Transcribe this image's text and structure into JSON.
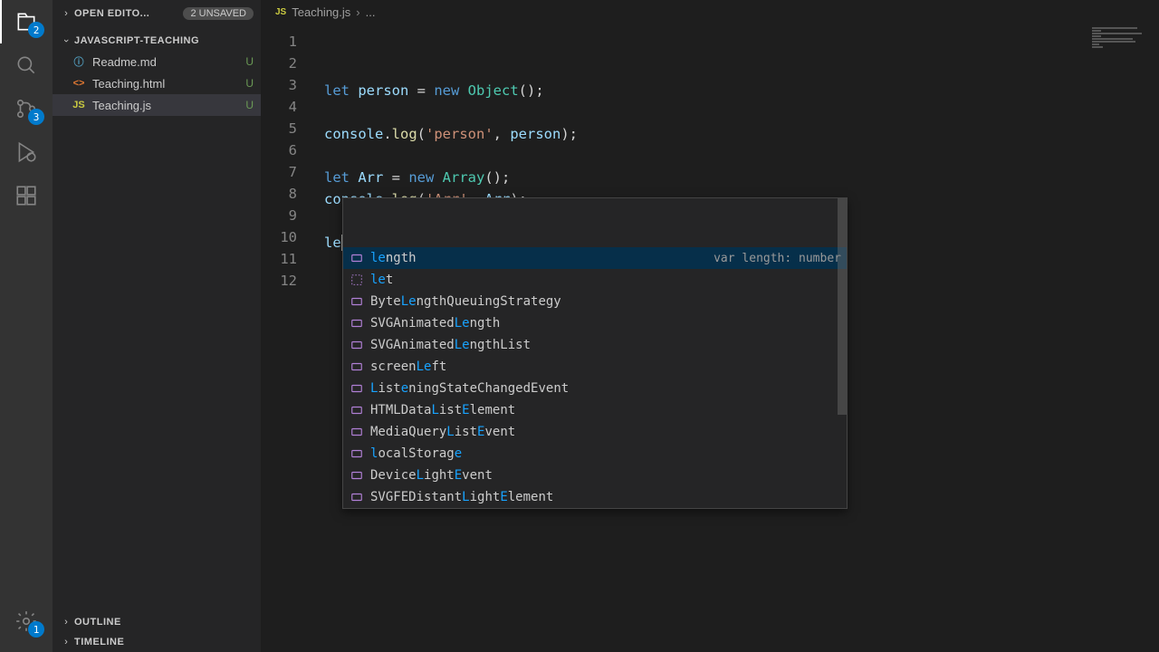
{
  "activity": {
    "explorer_badge": "2",
    "scm_badge": "3",
    "settings_badge": "1"
  },
  "sidebar": {
    "open_editors_label": "OPEN EDITO...",
    "unsaved_label": "2 UNSAVED",
    "project_label": "JAVASCRIPT-TEACHING",
    "files": [
      {
        "name": "Readme.md",
        "status": "U",
        "icon": "ⓘ",
        "color": "#519aba"
      },
      {
        "name": "Teaching.html",
        "status": "U",
        "icon": "<>",
        "color": "#e37933"
      },
      {
        "name": "Teaching.js",
        "status": "U",
        "icon": "JS",
        "color": "#cbcb41"
      }
    ],
    "outline_label": "OUTLINE",
    "timeline_label": "TIMELINE"
  },
  "breadcrumb": {
    "icon": "JS",
    "file": "Teaching.js",
    "rest": "..."
  },
  "code": {
    "lines": [
      {
        "n": 1,
        "tokens": [
          [
            "let ",
            "keyword"
          ],
          [
            "person ",
            "var"
          ],
          [
            "= ",
            "op"
          ],
          [
            "new ",
            "new"
          ],
          [
            "Object",
            "class"
          ],
          [
            "();",
            "punc"
          ]
        ]
      },
      {
        "n": 2,
        "tokens": []
      },
      {
        "n": 3,
        "tokens": [
          [
            "console",
            "obj"
          ],
          [
            ".",
            "punc"
          ],
          [
            "log",
            "func"
          ],
          [
            "(",
            "punc"
          ],
          [
            "'person'",
            "string"
          ],
          [
            ", ",
            "punc"
          ],
          [
            "person",
            "var"
          ],
          [
            ");",
            "punc"
          ]
        ]
      },
      {
        "n": 4,
        "tokens": []
      },
      {
        "n": 5,
        "tokens": [
          [
            "let ",
            "keyword"
          ],
          [
            "Arr ",
            "var"
          ],
          [
            "= ",
            "op"
          ],
          [
            "new ",
            "new"
          ],
          [
            "Array",
            "class"
          ],
          [
            "();",
            "punc"
          ]
        ]
      },
      {
        "n": 6,
        "tokens": [
          [
            "console",
            "obj"
          ],
          [
            ".",
            "punc"
          ],
          [
            "log",
            "func"
          ],
          [
            "(",
            "punc"
          ],
          [
            "'Arr'",
            "string"
          ],
          [
            ", ",
            "punc"
          ],
          [
            "Arr",
            "var"
          ],
          [
            ");",
            "punc"
          ]
        ]
      },
      {
        "n": 7,
        "tokens": []
      },
      {
        "n": 8,
        "tokens": [
          [
            "le",
            "var"
          ]
        ]
      },
      {
        "n": 9,
        "tokens": []
      },
      {
        "n": 10,
        "tokens": []
      },
      {
        "n": 11,
        "tokens": []
      },
      {
        "n": 12,
        "tokens": []
      }
    ]
  },
  "autocomplete": {
    "detail": "var length: number",
    "items": [
      {
        "parts": [
          [
            "le",
            true
          ],
          [
            "ngth",
            false
          ]
        ],
        "icon": "var",
        "selected": true
      },
      {
        "parts": [
          [
            "le",
            true
          ],
          [
            "t",
            false
          ]
        ],
        "icon": "snippet"
      },
      {
        "parts": [
          [
            "Byte",
            false
          ],
          [
            "Le",
            true
          ],
          [
            "ngthQueuingStrategy",
            false
          ]
        ],
        "icon": "var"
      },
      {
        "parts": [
          [
            "SVGAnimated",
            false
          ],
          [
            "Le",
            true
          ],
          [
            "ngth",
            false
          ]
        ],
        "icon": "var"
      },
      {
        "parts": [
          [
            "SVGAnimated",
            false
          ],
          [
            "Le",
            true
          ],
          [
            "ngthList",
            false
          ]
        ],
        "icon": "var"
      },
      {
        "parts": [
          [
            "screen",
            false
          ],
          [
            "Le",
            true
          ],
          [
            "ft",
            false
          ]
        ],
        "icon": "var"
      },
      {
        "parts": [
          [
            "L",
            true
          ],
          [
            "ist",
            false
          ],
          [
            "e",
            true
          ],
          [
            "ningStateChangedEvent",
            false
          ]
        ],
        "icon": "var"
      },
      {
        "parts": [
          [
            "HTMLData",
            false
          ],
          [
            "L",
            true
          ],
          [
            "ist",
            false
          ],
          [
            "E",
            true
          ],
          [
            "lement",
            false
          ]
        ],
        "icon": "var"
      },
      {
        "parts": [
          [
            "MediaQuery",
            false
          ],
          [
            "L",
            true
          ],
          [
            "ist",
            false
          ],
          [
            "E",
            true
          ],
          [
            "vent",
            false
          ]
        ],
        "icon": "var"
      },
      {
        "parts": [
          [
            "l",
            true
          ],
          [
            "ocalStorag",
            false
          ],
          [
            "e",
            true
          ]
        ],
        "icon": "var"
      },
      {
        "parts": [
          [
            "Device",
            false
          ],
          [
            "L",
            true
          ],
          [
            "ight",
            false
          ],
          [
            "E",
            true
          ],
          [
            "vent",
            false
          ]
        ],
        "icon": "var"
      },
      {
        "parts": [
          [
            "SVGFEDistant",
            false
          ],
          [
            "L",
            true
          ],
          [
            "ight",
            false
          ],
          [
            "E",
            true
          ],
          [
            "lement",
            false
          ]
        ],
        "icon": "var"
      }
    ]
  }
}
